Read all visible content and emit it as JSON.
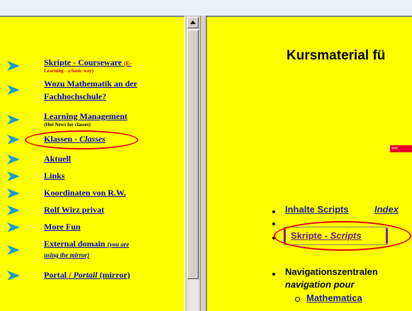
{
  "left_nav": {
    "items": [
      {
        "label": "Skripte - Courseware",
        "suffix": "(E-",
        "note": "Learning - a basic way)"
      },
      {
        "label": "Wozu Mathematik an der",
        "label2": "Fachhochschule?"
      },
      {
        "label": "Learning Management",
        "note": "(Hot News for classes)"
      },
      {
        "label": "Klassen - ",
        "label_italic": "Classes"
      },
      {
        "label": "Aktuell"
      },
      {
        "label": "Links"
      },
      {
        "label": "Koordinaten von R.W."
      },
      {
        "label": "Rolf Wirz privat"
      },
      {
        "label": "More Fun"
      },
      {
        "label": "External domain",
        "label_italic": "(you are",
        "label2": "using the mirror)"
      },
      {
        "label": "Portal / ",
        "label_italic": "Portail",
        "label_tail": " (mirror)"
      }
    ]
  },
  "right": {
    "title": "Kursmaterial fü",
    "red_mark_text": "==>",
    "links": {
      "inhalte": "Inhalte Scripts",
      "index": "Index",
      "skripte": "Skripte - ",
      "skripte_italic": "Scripts",
      "navigation": "Navigationszentralen",
      "navigation_italic": "navigation pour",
      "mathematica": "Mathematica"
    }
  },
  "colors": {
    "page_bg": "#ffff00",
    "link": "#0000cc",
    "highlight_ellipse": "#e00000",
    "arrow": "#1c9cc8"
  }
}
